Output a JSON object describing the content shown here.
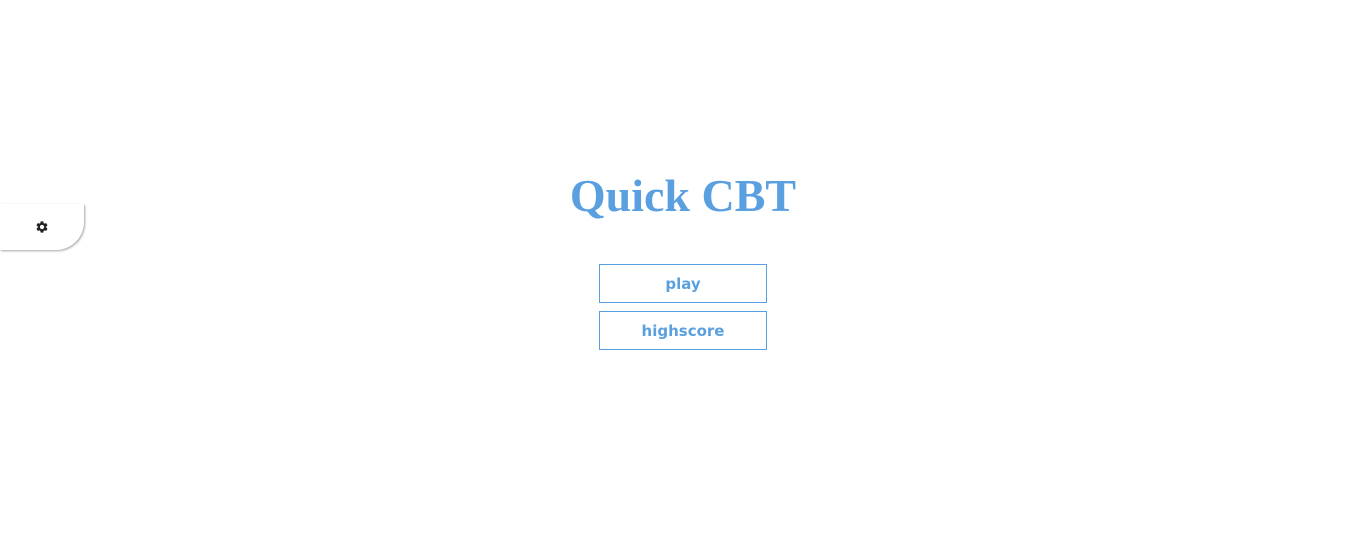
{
  "settings": {
    "icon": "gear-icon"
  },
  "title": "Quick CBT",
  "menu": {
    "play_label": "play",
    "highscore_label": "highscore"
  },
  "colors": {
    "accent": "#5aa0e0",
    "icon": "#222222",
    "background": "#ffffff"
  }
}
